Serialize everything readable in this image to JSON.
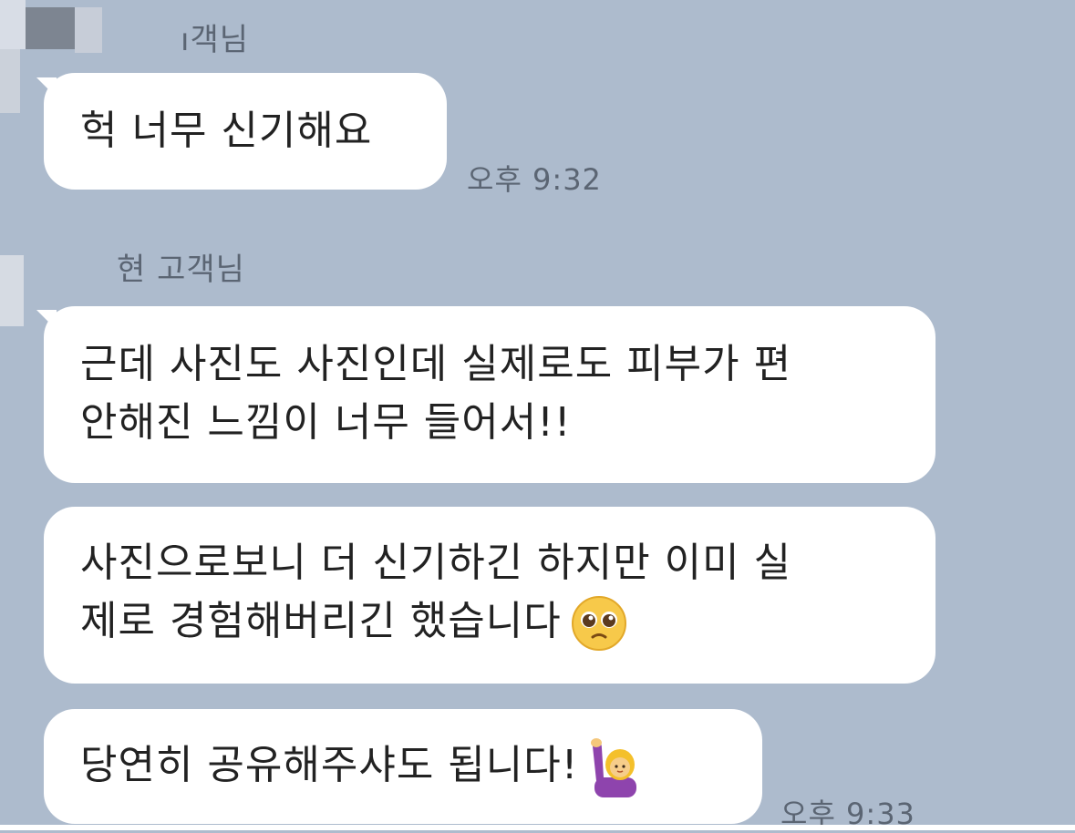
{
  "colors": {
    "background": "#adbbcd",
    "bubble": "#ffffff",
    "meta_text": "#5b6573",
    "message_text": "#222222"
  },
  "messages": [
    {
      "sender": "ı객님",
      "lines": [
        "헉 너무 신기해요"
      ],
      "time": "오후 9:32"
    },
    {
      "sender": "현 고객님",
      "bubbles": [
        {
          "lines": [
            "근데 사진도 사진인데 실제로도 피부가 편",
            "안해진 느낌이 너무 들어서!!"
          ]
        },
        {
          "lines": [
            "사진으로보니 더 신기하긴 하지만 이미 실",
            "제로 경험해버리긴 했습니다"
          ],
          "emoji": "pleading-face"
        },
        {
          "lines": [
            "당연히 공유해주샤도 됩니다!"
          ],
          "emoji": "person-raising-hand"
        }
      ],
      "time": "오후 9:33"
    }
  ]
}
